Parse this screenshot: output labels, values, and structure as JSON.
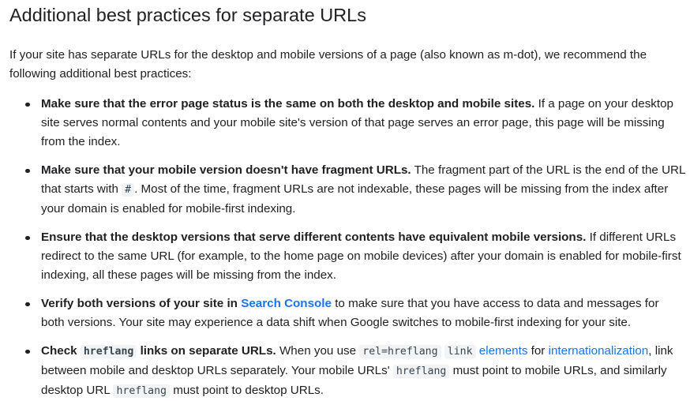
{
  "heading": "Additional best practices for separate URLs",
  "intro": "If your site has separate URLs for the desktop and mobile versions of a page (also known as m-dot), we recommend the following additional best practices:",
  "items": [
    {
      "bold": "Make sure that the error page status is the same on both the desktop and mobile sites.",
      "text": " If a page on your desktop site serves normal contents and your mobile site's version of that page serves an error page, this page will be missing from the index."
    },
    {
      "bold": "Make sure that your mobile version doesn't have fragment URLs.",
      "text_before": " The fragment part of the URL is the end of the URL that starts with ",
      "code": "#",
      "text_after": ". Most of the time, fragment URLs are not indexable, these pages will be missing from the index after your domain is enabled for mobile-first indexing."
    },
    {
      "bold": "Ensure that the desktop versions that serve different contents have equivalent mobile versions.",
      "text": " If different URLs redirect to the same URL (for example, to the home page on mobile devices) after your domain is enabled for mobile-first indexing, all these pages will be missing from the index."
    },
    {
      "bold": "Verify both versions of your site in ",
      "link": "Search Console",
      "text": " to make sure that you have access to data and messages for both versions. Your site may experience a data shift when Google switches to mobile-first indexing for your site."
    },
    {
      "bold_before": "Check ",
      "bold_code": "hreflang",
      "bold_after": " links on separate URLs.",
      "t1": " When you use ",
      "code1": "rel=hreflang",
      "link_code": "link",
      "link_text": " elements",
      "t2": " for ",
      "link2": "internationalization",
      "t3": ", link between mobile and desktop URLs separately. Your mobile URLs' ",
      "code2": "hreflang",
      "t4": " must point to mobile URLs, and similarly desktop URL ",
      "code3": "hreflang",
      "t5": " must point to desktop URLs."
    }
  ],
  "colors": {
    "text": "#202124",
    "link": "#1a73e8",
    "code_bg": "#f1f3f4"
  }
}
